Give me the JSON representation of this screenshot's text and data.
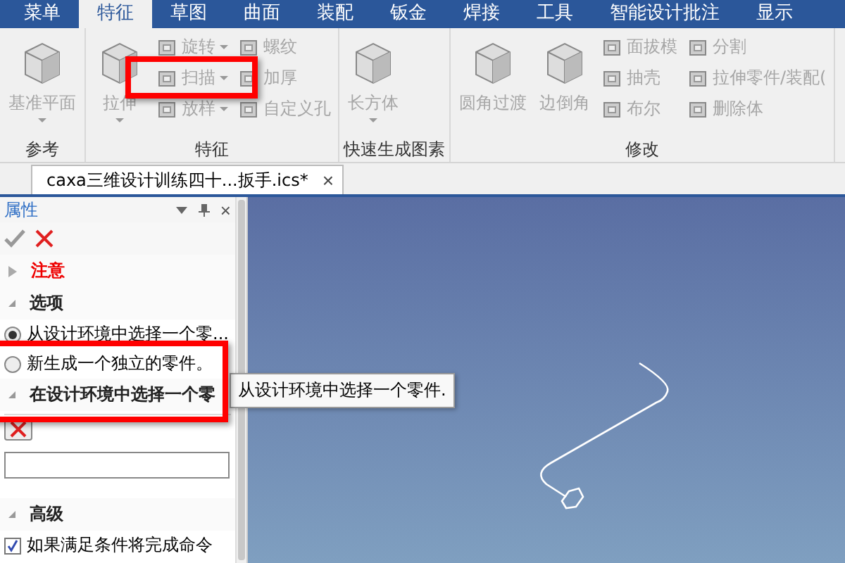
{
  "menu_tabs": [
    {
      "label": "菜单",
      "selected": false
    },
    {
      "label": "特征",
      "selected": true
    },
    {
      "label": "草图",
      "selected": false
    },
    {
      "label": "曲面",
      "selected": false
    },
    {
      "label": "装配",
      "selected": false
    },
    {
      "label": "钣金",
      "selected": false
    },
    {
      "label": "焊接",
      "selected": false
    },
    {
      "label": "工具",
      "selected": false
    },
    {
      "label": "智能设计批注",
      "selected": false
    },
    {
      "label": "显示",
      "selected": false
    }
  ],
  "ribbon_groups": [
    {
      "label": "参考",
      "items": [
        {
          "kind": "large",
          "label": "基准平面",
          "dropdown": true,
          "disabled": true
        }
      ]
    },
    {
      "label": "特征",
      "items": [
        {
          "kind": "large",
          "label": "拉伸",
          "dropdown": true,
          "disabled": true
        },
        {
          "kind": "column",
          "buttons": [
            {
              "label": "旋转",
              "dropdown": true,
              "disabled": true
            },
            {
              "label": "扫描",
              "dropdown": true,
              "disabled": true
            },
            {
              "label": "放样",
              "dropdown": true,
              "disabled": true
            }
          ]
        },
        {
          "kind": "column",
          "buttons": [
            {
              "label": "螺纹",
              "dropdown": false,
              "disabled": true
            },
            {
              "label": "加厚",
              "dropdown": false,
              "disabled": true
            },
            {
              "label": "自定义孔",
              "dropdown": false,
              "disabled": true
            }
          ]
        }
      ]
    },
    {
      "label": "快速生成图素",
      "items": [
        {
          "kind": "large",
          "label": "长方体",
          "dropdown": true,
          "disabled": true
        }
      ]
    },
    {
      "label": "修改",
      "items": [
        {
          "kind": "large",
          "label": "圆角过渡",
          "dropdown": false,
          "disabled": true
        },
        {
          "kind": "large",
          "label": "边倒角",
          "dropdown": false,
          "disabled": true
        },
        {
          "kind": "column",
          "buttons": [
            {
              "label": "面拔模",
              "dropdown": false,
              "disabled": true
            },
            {
              "label": "抽壳",
              "dropdown": false,
              "disabled": true
            },
            {
              "label": "布尔",
              "dropdown": false,
              "disabled": true
            }
          ]
        },
        {
          "kind": "column",
          "buttons": [
            {
              "label": "分割",
              "dropdown": false,
              "disabled": true
            },
            {
              "label": "拉伸零件/装配(",
              "dropdown": false,
              "disabled": true
            },
            {
              "label": "删除体",
              "dropdown": false,
              "disabled": true
            }
          ]
        }
      ]
    }
  ],
  "document_tab": {
    "label": "caxa三维设计训练四十...扳手.ics*",
    "close": "×"
  },
  "panel": {
    "title": "属性",
    "close": "×",
    "sections": [
      {
        "kind": "warning",
        "title": "注意",
        "expanded": false
      },
      {
        "kind": "options",
        "title": "选项",
        "expanded": true,
        "radios": [
          {
            "label": "从设计环境中选择一个零...",
            "selected": true
          },
          {
            "label": "新生成一个独立的零件。",
            "selected": false
          }
        ]
      },
      {
        "kind": "selector",
        "title": "在设计环境中选择一个零",
        "expanded": true
      },
      {
        "kind": "checks",
        "title": "高级",
        "expanded": true,
        "checks": [
          {
            "label": "如果满足条件将完成命令",
            "checked": true
          }
        ]
      }
    ]
  },
  "tooltip": "从设计环境中选择一个零件."
}
